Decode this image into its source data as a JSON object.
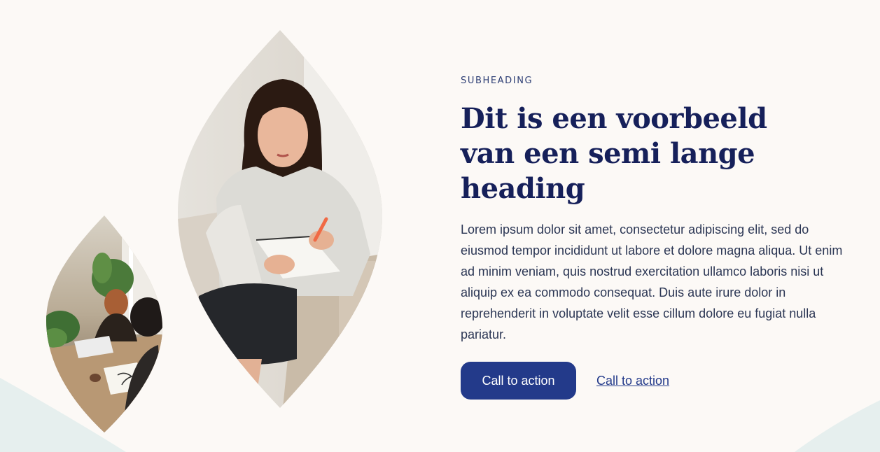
{
  "section": {
    "subheading": "SUBHEADING",
    "heading": "Dit is een voorbeeld van een semi lange heading",
    "body": "Lorem ipsum dolor sit amet, consectetur adipiscing elit, sed do eiusmod tempor incididunt ut labore et dolore magna aliqua. Ut enim ad minim veniam, quis nostrud exercitation ullamco laboris nisi ut aliquip ex ea commodo consequat. Duis aute irure dolor in reprehenderit in voluptate velit esse cillum dolore eu fugiat nulla pariatur.",
    "primary_cta": "Call to action",
    "secondary_cta": "Call to action"
  },
  "colors": {
    "background": "#fcf9f6",
    "accent": "#233a8a",
    "heading": "#16205a",
    "body_text": "#2b3654",
    "curve": "#e6efee"
  },
  "images": {
    "large": "woman-writing-notebook-photo",
    "small": "two-people-meeting-table-photo"
  }
}
